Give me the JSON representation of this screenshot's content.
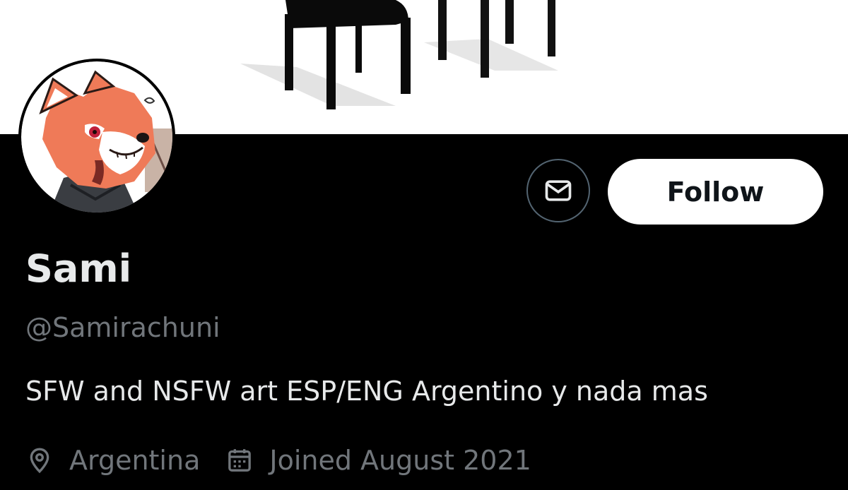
{
  "profile": {
    "display_name": "Sami",
    "handle": "@Samirachuni",
    "bio": "SFW and NSFW art ESP/ENG Argentino y nada mas",
    "location": "Argentina",
    "joined": "Joined August 2021"
  },
  "actions": {
    "message_icon": "envelope-icon",
    "follow_label": "Follow"
  },
  "icons": {
    "location": "map-pin-icon",
    "joined": "calendar-icon"
  },
  "colors": {
    "background": "#000000",
    "primary_text": "#e7e9ea",
    "secondary_text": "#71767b",
    "button_border": "#536471",
    "follow_bg": "#ffffff",
    "follow_text": "#0f1419",
    "avatar_fur": "#ef7a58"
  }
}
